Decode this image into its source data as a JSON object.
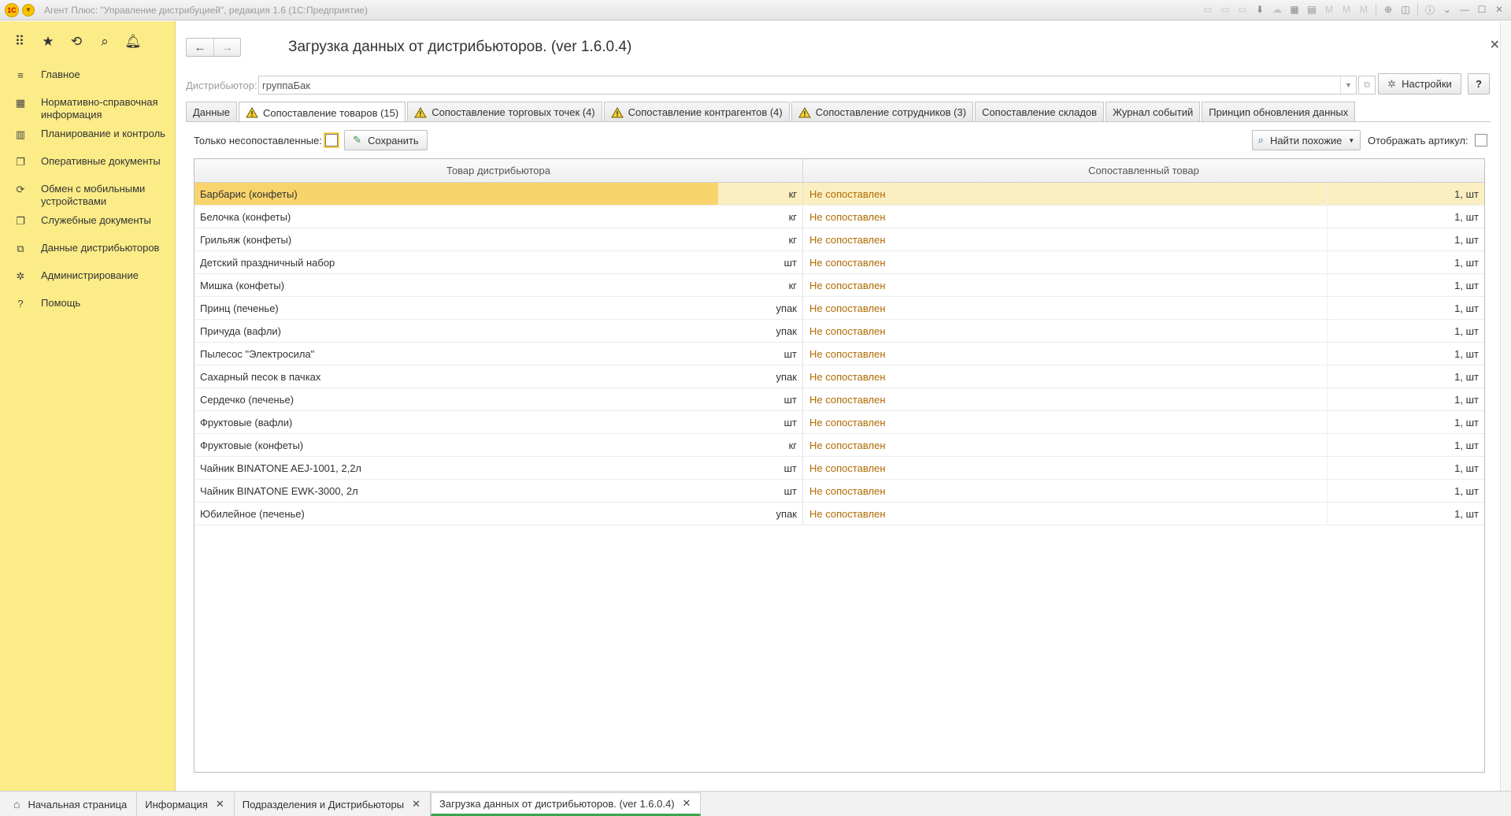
{
  "app": {
    "title": "Агент Плюс: \"Управление дистрибуцией\", редакция 1.6  (1С:Предприятие)",
    "logo_text": "1С"
  },
  "sidebar": {
    "items": [
      {
        "icon": "menu-lines-icon",
        "glyph": "≡",
        "label": "Главное"
      },
      {
        "icon": "reference-icon",
        "glyph": "▦",
        "label": "Нормативно-справочная информация"
      },
      {
        "icon": "chart-icon",
        "glyph": "▥",
        "label": "Планирование и контроль"
      },
      {
        "icon": "documents-icon",
        "glyph": "❐",
        "label": "Оперативные документы"
      },
      {
        "icon": "sync-icon",
        "glyph": "⟳",
        "label": "Обмен с мобильными устройствами"
      },
      {
        "icon": "service-docs-icon",
        "glyph": "❐",
        "label": "Служебные документы"
      },
      {
        "icon": "distributor-data-icon",
        "glyph": "⧉",
        "label": "Данные дистрибьюторов"
      },
      {
        "icon": "gear-icon",
        "glyph": "✲",
        "label": "Администрирование"
      },
      {
        "icon": "help-icon",
        "glyph": "?",
        "label": "Помощь"
      }
    ]
  },
  "form": {
    "title": "Загрузка данных от дистрибьюторов. (ver 1.6.0.4)",
    "distributor_label": "Дистрибьютор:",
    "distributor_value": "группаБак",
    "settings_label": "Настройки",
    "help_label": "?",
    "tabs": [
      {
        "label": "Данные",
        "warn": false
      },
      {
        "label": "Сопоставление товаров (15)",
        "warn": true
      },
      {
        "label": "Сопоставление торговых точек (4)",
        "warn": true
      },
      {
        "label": "Сопоставление контрагентов (4)",
        "warn": true
      },
      {
        "label": "Сопоставление сотрудников (3)",
        "warn": true
      },
      {
        "label": "Сопоставление складов",
        "warn": false
      },
      {
        "label": "Журнал событий",
        "warn": false
      },
      {
        "label": "Принцип обновления данных",
        "warn": false
      }
    ],
    "only_unmatched_label": "Только несопоставленные:",
    "save_label": "Сохранить",
    "find_similar_label": "Найти похожие",
    "show_article_label": "Отображать артикул:"
  },
  "table": {
    "headers": [
      "Товар дистрибьютора",
      "Сопоставленный товар"
    ],
    "rows": [
      {
        "name": "Барбарис (конфеты)",
        "unit": "кг",
        "match": "Не сопоставлен",
        "qty": "1, шт"
      },
      {
        "name": "Белочка (конфеты)",
        "unit": "кг",
        "match": "Не сопоставлен",
        "qty": "1, шт"
      },
      {
        "name": "Грильяж (конфеты)",
        "unit": "кг",
        "match": "Не сопоставлен",
        "qty": "1, шт"
      },
      {
        "name": "Детский праздничный набор",
        "unit": "шт",
        "match": "Не сопоставлен",
        "qty": "1, шт"
      },
      {
        "name": "Мишка (конфеты)",
        "unit": "кг",
        "match": "Не сопоставлен",
        "qty": "1, шт"
      },
      {
        "name": "Принц (печенье)",
        "unit": "упак",
        "match": "Не сопоставлен",
        "qty": "1, шт"
      },
      {
        "name": "Причуда (вафли)",
        "unit": "упак",
        "match": "Не сопоставлен",
        "qty": "1, шт"
      },
      {
        "name": "Пылесос \"Электросила\"",
        "unit": "шт",
        "match": "Не сопоставлен",
        "qty": "1, шт"
      },
      {
        "name": "Сахарный песок в пачках",
        "unit": "упак",
        "match": "Не сопоставлен",
        "qty": "1, шт"
      },
      {
        "name": "Сердечко (печенье)",
        "unit": "шт",
        "match": "Не сопоставлен",
        "qty": "1, шт"
      },
      {
        "name": "Фруктовые (вафли)",
        "unit": "шт",
        "match": "Не сопоставлен",
        "qty": "1, шт"
      },
      {
        "name": "Фруктовые (конфеты)",
        "unit": "кг",
        "match": "Не сопоставлен",
        "qty": "1, шт"
      },
      {
        "name": "Чайник BINATONE  AEJ-1001,  2,2л",
        "unit": "шт",
        "match": "Не сопоставлен",
        "qty": "1, шт"
      },
      {
        "name": "Чайник BINATONE  EWK-3000,  2л",
        "unit": "шт",
        "match": "Не сопоставлен",
        "qty": "1, шт"
      },
      {
        "name": "Юбилейное (печенье)",
        "unit": "упак",
        "match": "Не сопоставлен",
        "qty": "1, шт"
      }
    ]
  },
  "bottom_tabs": [
    {
      "label": "Начальная страница",
      "home": true,
      "closable": false
    },
    {
      "label": "Информация",
      "home": false,
      "closable": true
    },
    {
      "label": "Подразделения и Дистрибьюторы",
      "home": false,
      "closable": true
    },
    {
      "label": "Загрузка данных от дистрибьюторов. (ver 1.6.0.4)",
      "home": false,
      "closable": true,
      "active": true
    }
  ],
  "colors": {
    "sidebar_bg": "#fbec88",
    "selected_row": "#fbefc2",
    "selected_cell": "#f9d46c",
    "unmatched_text": "#b06a00",
    "active_tab_underline": "#3aa54a"
  }
}
